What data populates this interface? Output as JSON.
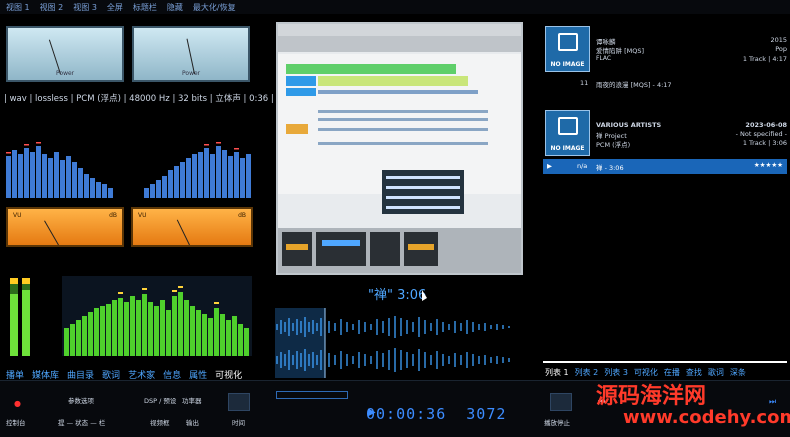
{
  "menu": [
    "视图 1",
    "视图 2",
    "视图 3",
    "全屏",
    "标题栏",
    "隐藏",
    "最大化/恢复"
  ],
  "vu_top": {
    "left_label": "Power",
    "right_label": "Power"
  },
  "format_line": "| wav | lossless | PCM (浮点) | 48000 Hz | 32 bits | 立体声 | 0:36 |",
  "vu_orange": {
    "label_vu": "VU",
    "label_db": "dB"
  },
  "left_tabs": [
    "播单",
    "媒体库",
    "曲目录",
    "歌词",
    "艺术家",
    "信息",
    "属性",
    "可视化"
  ],
  "left_tab_active": 7,
  "now_playing": {
    "title": "\"禅\" 3:06"
  },
  "album1": {
    "no_image": "NO IMAGE",
    "artist": "谭咏麟",
    "album": "爱情陷阱 [MQS]",
    "format": "FLAC",
    "year": "2015",
    "genre": "Pop",
    "tracks": "1 Track | 4:17",
    "track_no": "11",
    "track_title": "雨夜的浪漫 [MQS] - 4:17"
  },
  "album2": {
    "no_image": "NO IMAGE",
    "artist": "VARIOUS ARTISTS",
    "album": "禅 Project",
    "format": "PCM (浮点)",
    "date": "2023-06-08",
    "genre": "- Not specified -",
    "tracks": "1 Track | 3:06",
    "track_no": "n/a",
    "track_title": "禅 - 3:06",
    "rating": "★★★★★"
  },
  "right_tabs": [
    "列表 1",
    "列表 2",
    "列表 3",
    "可视化",
    "在播",
    "查找",
    "歌词",
    "深条"
  ],
  "right_tab_active": 0,
  "bottom": {
    "console": "控制台",
    "params": "参数选项",
    "status_line": "提 — 状态 — 栏",
    "dsp": "DSP / 预设",
    "effects": "功率器",
    "visualizer": "视频框",
    "output": "输出",
    "time_btn": "时间",
    "stop_after": "播放停止",
    "timer": "00:00:36",
    "bitrate": "3072"
  },
  "watermark": {
    "text": "源码海洋网",
    "url": "www.codehy.com"
  }
}
